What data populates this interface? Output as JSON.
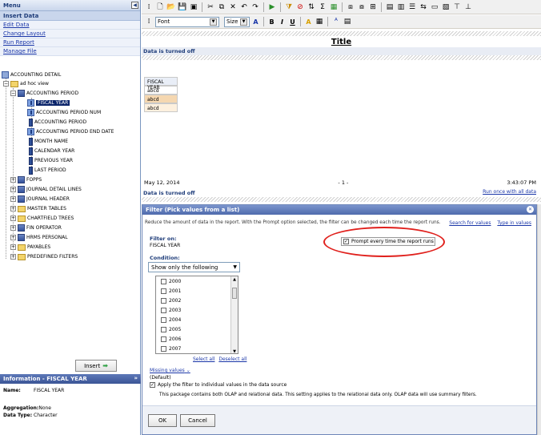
{
  "menu": {
    "title": "Menu",
    "section": "Insert Data",
    "links": [
      "Edit Data",
      "Change Layout",
      "Run Report",
      "Manage File"
    ]
  },
  "tree": {
    "root": "ACCOUNTING DETAIL",
    "view": "ad hoc view",
    "accounting_period": "ACCOUNTING PERIOD",
    "children": [
      "FISCAL YEAR",
      "ACCOUNTING PERIOD NUM",
      "ACCOUNTING PERIOD",
      "ACCOUNTING PERIOD END DATE",
      "MONTH NAME",
      "CALENDAR YEAR",
      "PREVIOUS YEAR",
      "LAST PERIOD"
    ],
    "others": [
      "FOPPS",
      "JOURNAL DETAIL LINES",
      "JOURNAL HEADER",
      "MASTER TABLES",
      "CHARTFIELD TREES",
      "FIN OPERATOR",
      "HRMS PERSONAL",
      "PAYABLES",
      "PREDEFINED FILTERS"
    ]
  },
  "insert_button": "Insert",
  "info": {
    "header": "Information - FISCAL YEAR",
    "name_label": "Name:",
    "name_value": "FISCAL YEAR",
    "aggregation_label": "Aggregation:",
    "aggregation_value": "None",
    "datatype_label": "Data Type:",
    "datatype_value": "Character"
  },
  "toolbar": {
    "font": "Font",
    "size": "Size",
    "bold": "B",
    "italic": "I",
    "underline": "U"
  },
  "report": {
    "status": "Data is turned off",
    "title": "Title",
    "table_header": "FISCAL YEAR",
    "rows": [
      "abcd",
      "abcd",
      "abcd"
    ],
    "date": "May 12, 2014",
    "page": "- 1 -",
    "time": "3:43:07 PM",
    "run_link": "Run once with all data"
  },
  "filter": {
    "title": "Filter (Pick values from a list)",
    "description": "Reduce the amount of data in the report. With the Prompt option selected, the filter can be changed each time the report runs.",
    "search_link": "Search for values",
    "type_link": "Type in values",
    "filter_on_label": "Filter on:",
    "filter_on_value": "FISCAL YEAR",
    "prompt_label": "Prompt every time the report runs",
    "condition_label": "Condition:",
    "condition_value": "Show only the following",
    "years": [
      "2000",
      "2001",
      "2002",
      "2003",
      "2004",
      "2005",
      "2006",
      "2007"
    ],
    "select_all": "Select all",
    "deselect_all": "Deselect all",
    "missing_values": "Missing values",
    "default": "(Default)",
    "apply_label": "Apply the filter to individual values in the data source",
    "note": "This package contains both OLAP and relational data. This setting applies to the relational data only. OLAP data will use summary filters.",
    "ok": "OK",
    "cancel": "Cancel"
  },
  "colors": {
    "accent": "#1f3d7a",
    "link": "#1a36a8",
    "highlight": "#e0201c",
    "selected_row": "#0a246a"
  }
}
